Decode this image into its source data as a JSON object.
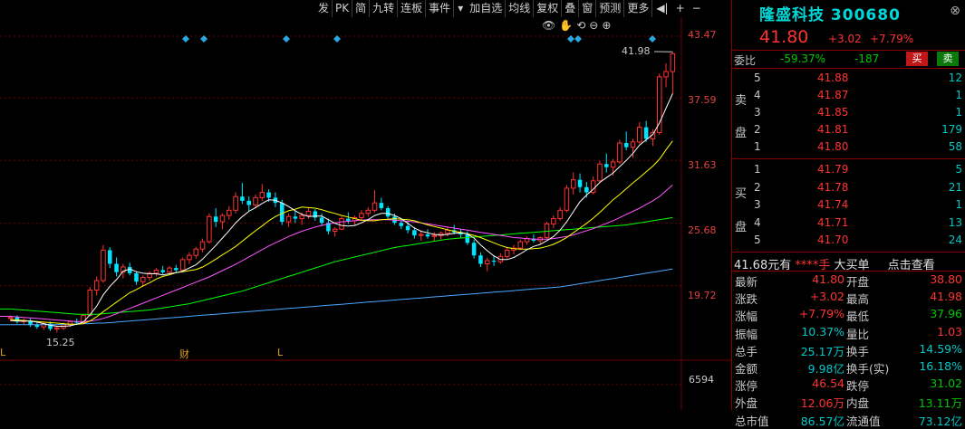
{
  "toolbar": {
    "buttons": [
      "发",
      "PK",
      "简",
      "九转",
      "连板",
      "事件",
      "加自选",
      "均线",
      "复权",
      "叠",
      "窗",
      "预测",
      "更多"
    ],
    "dropdown_icon": "triangle-down-icon",
    "icons": [
      "back-arrow-icon",
      "zoom-in-icon",
      "zoom-out-icon"
    ]
  },
  "chart_icons": [
    "eye-icon",
    "hand-icon",
    "replay-icon",
    "minus-icon",
    "plus-icon"
  ],
  "colors": {
    "up": "#ff3232",
    "down": "#00e5ff",
    "ma5": "#ffffff",
    "ma10": "#ffff00",
    "ma20": "#ff55ff",
    "ma60": "#00ff00",
    "ma120": "#4aa8ff",
    "grid": "#6b0000",
    "panel_border": "#8b0000"
  },
  "chart_data": {
    "type": "candlestick",
    "y_ticks": [
      "43.47",
      "37.59",
      "31.63",
      "25.68",
      "19.72"
    ],
    "ylim": [
      14.0,
      43.47
    ],
    "max_label": "41.98",
    "min_label": "15.25",
    "markers_bottom": [
      "财",
      "L"
    ],
    "volume_label": "6594",
    "ohlc": [
      [
        16.6,
        16.9,
        16.3,
        16.7
      ],
      [
        16.7,
        16.9,
        16.1,
        16.3
      ],
      [
        16.3,
        16.6,
        16.0,
        16.4
      ],
      [
        16.4,
        16.6,
        15.8,
        16.0
      ],
      [
        16.0,
        16.3,
        15.6,
        15.8
      ],
      [
        15.8,
        16.2,
        15.5,
        16.1
      ],
      [
        16.1,
        16.3,
        15.4,
        15.6
      ],
      [
        15.6,
        15.9,
        15.25,
        15.7
      ],
      [
        15.7,
        16.2,
        15.5,
        16.0
      ],
      [
        16.0,
        16.4,
        15.8,
        16.3
      ],
      [
        16.3,
        16.6,
        16.0,
        16.2
      ],
      [
        16.2,
        17.0,
        16.1,
        16.9
      ],
      [
        16.9,
        19.6,
        16.8,
        19.3
      ],
      [
        19.3,
        20.6,
        18.8,
        20.2
      ],
      [
        20.2,
        23.6,
        20.0,
        23.1
      ],
      [
        23.1,
        23.4,
        21.4,
        21.8
      ],
      [
        21.8,
        22.4,
        20.6,
        21.0
      ],
      [
        21.0,
        21.8,
        20.4,
        21.5
      ],
      [
        21.5,
        21.9,
        20.7,
        20.9
      ],
      [
        20.9,
        21.1,
        19.8,
        20.1
      ],
      [
        20.1,
        20.7,
        19.6,
        20.5
      ],
      [
        20.5,
        21.1,
        20.2,
        20.9
      ],
      [
        20.9,
        21.4,
        20.6,
        21.2
      ],
      [
        21.2,
        21.6,
        20.8,
        21.0
      ],
      [
        21.0,
        21.6,
        20.9,
        21.4
      ],
      [
        21.4,
        21.7,
        21.0,
        21.2
      ],
      [
        21.2,
        22.4,
        21.1,
        22.2
      ],
      [
        22.2,
        22.9,
        21.8,
        22.6
      ],
      [
        22.6,
        23.4,
        22.3,
        23.2
      ],
      [
        23.2,
        24.2,
        22.9,
        23.9
      ],
      [
        23.9,
        26.6,
        23.7,
        26.3
      ],
      [
        26.3,
        27.1,
        25.3,
        25.8
      ],
      [
        25.8,
        26.6,
        25.1,
        26.4
      ],
      [
        26.4,
        27.3,
        26.0,
        26.9
      ],
      [
        26.9,
        28.6,
        26.6,
        28.2
      ],
      [
        28.2,
        29.5,
        27.5,
        27.8
      ],
      [
        27.8,
        28.2,
        26.8,
        27.4
      ],
      [
        27.4,
        28.4,
        27.1,
        28.1
      ],
      [
        28.1,
        29.4,
        27.8,
        28.6
      ],
      [
        28.6,
        28.9,
        27.7,
        28.1
      ],
      [
        28.1,
        28.6,
        27.2,
        27.6
      ],
      [
        27.6,
        27.9,
        25.5,
        25.8
      ],
      [
        25.8,
        26.6,
        25.3,
        26.3
      ],
      [
        26.3,
        26.8,
        25.7,
        26.1
      ],
      [
        26.1,
        26.7,
        25.5,
        26.4
      ],
      [
        26.4,
        27.1,
        26.1,
        26.8
      ],
      [
        26.8,
        27.0,
        25.9,
        26.2
      ],
      [
        26.2,
        26.6,
        25.4,
        25.7
      ],
      [
        25.7,
        26.1,
        24.6,
        24.9
      ],
      [
        24.9,
        25.3,
        24.4,
        25.1
      ],
      [
        25.1,
        26.3,
        25.0,
        26.1
      ],
      [
        26.1,
        26.7,
        25.6,
        25.9
      ],
      [
        25.9,
        26.4,
        25.5,
        26.2
      ],
      [
        26.2,
        26.9,
        25.9,
        26.6
      ],
      [
        26.6,
        27.2,
        26.3,
        26.9
      ],
      [
        26.9,
        28.8,
        26.7,
        27.6
      ],
      [
        27.6,
        28.1,
        26.9,
        27.1
      ],
      [
        27.1,
        27.3,
        26.1,
        26.3
      ],
      [
        26.3,
        26.6,
        25.5,
        25.7
      ],
      [
        25.7,
        26.0,
        25.1,
        25.4
      ],
      [
        25.4,
        25.9,
        24.7,
        25.0
      ],
      [
        25.0,
        25.3,
        24.2,
        24.5
      ],
      [
        24.5,
        24.9,
        24.0,
        24.6
      ],
      [
        24.6,
        25.1,
        24.2,
        24.4
      ],
      [
        24.4,
        24.8,
        23.9,
        24.5
      ],
      [
        24.5,
        24.9,
        24.1,
        24.7
      ],
      [
        24.7,
        25.3,
        24.4,
        25.0
      ],
      [
        25.0,
        25.5,
        24.6,
        24.8
      ],
      [
        24.8,
        25.1,
        24.3,
        24.6
      ],
      [
        24.6,
        24.9,
        23.6,
        23.8
      ],
      [
        23.8,
        24.1,
        22.3,
        22.6
      ],
      [
        22.6,
        22.9,
        21.5,
        21.8
      ],
      [
        21.8,
        22.4,
        21.1,
        22.1
      ],
      [
        22.1,
        22.6,
        21.6,
        22.0
      ],
      [
        22.0,
        22.8,
        21.8,
        22.5
      ],
      [
        22.5,
        23.4,
        22.3,
        23.1
      ],
      [
        23.1,
        23.6,
        22.7,
        23.3
      ],
      [
        23.3,
        24.1,
        23.1,
        23.9
      ],
      [
        23.9,
        24.4,
        23.6,
        24.2
      ],
      [
        24.2,
        24.6,
        23.8,
        24.0
      ],
      [
        24.0,
        24.4,
        23.7,
        24.3
      ],
      [
        24.3,
        25.8,
        24.2,
        25.6
      ],
      [
        25.6,
        26.4,
        25.2,
        26.1
      ],
      [
        26.1,
        27.2,
        25.9,
        26.9
      ],
      [
        26.9,
        29.3,
        26.7,
        29.0
      ],
      [
        29.0,
        30.5,
        28.4,
        29.8
      ],
      [
        29.8,
        30.4,
        28.6,
        29.1
      ],
      [
        29.1,
        29.6,
        28.1,
        28.6
      ],
      [
        28.6,
        30.1,
        28.4,
        29.7
      ],
      [
        29.7,
        31.6,
        29.5,
        31.3
      ],
      [
        31.3,
        32.3,
        30.5,
        31.0
      ],
      [
        31.0,
        31.8,
        30.2,
        31.5
      ],
      [
        31.5,
        33.6,
        31.3,
        33.3
      ],
      [
        33.3,
        34.4,
        32.6,
        32.9
      ],
      [
        32.9,
        33.7,
        31.9,
        33.4
      ],
      [
        33.4,
        35.3,
        33.2,
        34.8
      ],
      [
        34.8,
        35.4,
        33.4,
        33.7
      ],
      [
        33.7,
        34.6,
        33.0,
        34.3
      ],
      [
        34.3,
        39.9,
        34.1,
        39.6
      ],
      [
        39.6,
        40.9,
        38.6,
        40.1
      ],
      [
        40.1,
        41.98,
        37.96,
        41.8
      ]
    ],
    "ma5": [
      16.4,
      16.35,
      16.35,
      16.35,
      16.25,
      16.1,
      15.95,
      15.85,
      15.85,
      15.9,
      16.05,
      16.25,
      16.95,
      17.75,
      18.85,
      19.65,
      20.3,
      21.1,
      21.3,
      21.05,
      20.9,
      20.85,
      20.85,
      20.75,
      20.85,
      20.95,
      21.1,
      21.4,
      21.7,
      22.25,
      22.9,
      23.55,
      24.25,
      24.95,
      25.7,
      26.3,
      26.8,
      27.15,
      27.55,
      27.9,
      27.85,
      27.6,
      27.25,
      26.85,
      26.5,
      26.3,
      26.35,
      26.35,
      26.0,
      25.65,
      25.45,
      25.4,
      25.45,
      25.7,
      26.0,
      26.4,
      26.6,
      26.6,
      26.4,
      26.1,
      25.65,
      25.2,
      24.9,
      24.75,
      24.6,
      24.55,
      24.6,
      24.7,
      24.75,
      24.65,
      24.25,
      23.6,
      23.05,
      22.55,
      22.2,
      22.2,
      22.4,
      22.75,
      23.15,
      23.45,
      23.65,
      24.0,
      24.4,
      25.0,
      25.8,
      26.75,
      27.7,
      28.35,
      28.9,
      29.55,
      30.0,
      30.45,
      31.05,
      31.65,
      32.3,
      33.1,
      33.6,
      34.1,
      35.2,
      36.6,
      38.0
    ],
    "ma10": [
      16.5,
      16.45,
      16.4,
      16.35,
      16.3,
      16.25,
      16.2,
      16.15,
      16.1,
      16.05,
      16.05,
      16.1,
      16.35,
      16.75,
      17.25,
      17.7,
      18.15,
      18.6,
      19.05,
      19.35,
      19.7,
      20.0,
      20.35,
      20.6,
      20.75,
      20.95,
      21.05,
      21.15,
      21.25,
      21.5,
      21.85,
      22.25,
      22.65,
      23.05,
      23.45,
      23.95,
      24.45,
      24.95,
      25.4,
      25.9,
      26.3,
      26.6,
      26.85,
      27.0,
      27.2,
      27.15,
      27.1,
      26.95,
      26.75,
      26.6,
      26.4,
      26.25,
      26.1,
      25.95,
      25.9,
      25.9,
      26.0,
      26.05,
      26.1,
      26.05,
      26.0,
      25.9,
      25.7,
      25.5,
      25.35,
      25.2,
      25.05,
      24.9,
      24.8,
      24.65,
      24.5,
      24.3,
      24.05,
      23.8,
      23.55,
      23.35,
      23.25,
      23.2,
      23.2,
      23.25,
      23.3,
      23.45,
      23.65,
      23.95,
      24.3,
      24.75,
      25.2,
      25.65,
      26.15,
      26.7,
      27.3,
      27.9,
      28.4,
      28.95,
      29.5,
      30.0,
      30.55,
      31.1,
      31.75,
      32.65,
      33.5
    ],
    "ma20": [
      16.8,
      16.75,
      16.7,
      16.65,
      16.6,
      16.55,
      16.5,
      16.45,
      16.4,
      16.35,
      16.3,
      16.3,
      16.35,
      16.45,
      16.6,
      16.8,
      17.05,
      17.3,
      17.55,
      17.8,
      18.05,
      18.3,
      18.55,
      18.8,
      19.05,
      19.3,
      19.55,
      19.8,
      20.05,
      20.3,
      20.55,
      20.85,
      21.15,
      21.45,
      21.75,
      22.1,
      22.45,
      22.8,
      23.15,
      23.5,
      23.8,
      24.1,
      24.4,
      24.65,
      24.9,
      25.1,
      25.3,
      25.45,
      25.6,
      25.7,
      25.8,
      25.85,
      25.9,
      25.95,
      26.0,
      26.0,
      26.0,
      26.0,
      25.95,
      25.9,
      25.85,
      25.8,
      25.7,
      25.6,
      25.5,
      25.4,
      25.3,
      25.2,
      25.1,
      25.0,
      24.9,
      24.8,
      24.7,
      24.6,
      24.5,
      24.4,
      24.3,
      24.25,
      24.2,
      24.15,
      24.15,
      24.15,
      24.2,
      24.3,
      24.4,
      24.55,
      24.75,
      24.95,
      25.15,
      25.4,
      25.65,
      25.9,
      26.2,
      26.5,
      26.8,
      27.1,
      27.45,
      27.8,
      28.2,
      28.75,
      29.3
    ],
    "ma60": [
      17.5,
      17.45,
      17.4,
      17.35,
      17.3,
      17.25,
      17.2,
      17.15,
      17.1,
      17.05,
      17.0,
      17.0,
      17.0,
      17.0,
      17.05,
      17.1,
      17.15,
      17.2,
      17.25,
      17.3,
      17.35,
      17.4,
      17.5,
      17.6,
      17.7,
      17.8,
      17.9,
      18.0,
      18.15,
      18.3,
      18.45,
      18.6,
      18.75,
      18.9,
      19.05,
      19.2,
      19.4,
      19.6,
      19.8,
      20.0,
      20.2,
      20.4,
      20.6,
      20.8,
      21.0,
      21.2,
      21.4,
      21.6,
      21.8,
      22.0,
      22.15,
      22.3,
      22.45,
      22.6,
      22.75,
      22.9,
      23.05,
      23.2,
      23.35,
      23.45,
      23.55,
      23.65,
      23.75,
      23.85,
      23.95,
      24.05,
      24.15,
      24.2,
      24.25,
      24.3,
      24.35,
      24.4,
      24.45,
      24.5,
      24.55,
      24.6,
      24.65,
      24.7,
      24.75,
      24.8,
      24.85,
      24.9,
      24.95,
      25.0,
      25.05,
      25.1,
      25.15,
      25.2,
      25.25,
      25.3,
      25.35,
      25.4,
      25.45,
      25.5,
      25.6,
      25.7,
      25.8,
      25.9,
      26.0,
      26.1,
      26.2
    ],
    "ma120": [
      16.0,
      16.0,
      16.0,
      16.0,
      16.0,
      16.0,
      16.0,
      16.0,
      16.05,
      16.05,
      16.05,
      16.1,
      16.1,
      16.15,
      16.15,
      16.2,
      16.25,
      16.3,
      16.35,
      16.4,
      16.45,
      16.5,
      16.55,
      16.6,
      16.65,
      16.7,
      16.75,
      16.8,
      16.85,
      16.9,
      16.95,
      17.0,
      17.05,
      17.1,
      17.15,
      17.2,
      17.25,
      17.3,
      17.35,
      17.4,
      17.45,
      17.5,
      17.55,
      17.6,
      17.65,
      17.7,
      17.75,
      17.8,
      17.85,
      17.9,
      17.95,
      18.0,
      18.05,
      18.1,
      18.15,
      18.2,
      18.25,
      18.3,
      18.35,
      18.4,
      18.45,
      18.5,
      18.55,
      18.6,
      18.65,
      18.7,
      18.75,
      18.8,
      18.85,
      18.9,
      18.95,
      19.0,
      19.05,
      19.1,
      19.15,
      19.2,
      19.25,
      19.3,
      19.35,
      19.4,
      19.45,
      19.5,
      19.55,
      19.6,
      19.7,
      19.8,
      19.9,
      20.0,
      20.1,
      20.2,
      20.3,
      20.4,
      20.5,
      20.6,
      20.7,
      20.8,
      20.9,
      21.0,
      21.1,
      21.2,
      21.3
    ]
  },
  "quote": {
    "name": "隆盛科技",
    "code": "300680",
    "price": "41.80",
    "change": "+3.02",
    "change_pct": "+7.79%",
    "weibi_label": "委比",
    "weibi_pct": "-59.37%",
    "weibi_diff": "-187",
    "buy_label": "买",
    "sell_label": "卖",
    "sell_side_label": [
      "卖",
      "盘"
    ],
    "buy_side_label": [
      "买",
      "盘"
    ],
    "asks": [
      {
        "level": "5",
        "price": "41.88",
        "vol": "12"
      },
      {
        "level": "4",
        "price": "41.87",
        "vol": "1"
      },
      {
        "level": "3",
        "price": "41.85",
        "vol": "1"
      },
      {
        "level": "2",
        "price": "41.81",
        "vol": "179"
      },
      {
        "level": "1",
        "price": "41.80",
        "vol": "58"
      }
    ],
    "bids": [
      {
        "level": "1",
        "price": "41.79",
        "vol": "5"
      },
      {
        "level": "2",
        "price": "41.78",
        "vol": "21"
      },
      {
        "level": "3",
        "price": "41.74",
        "vol": "1"
      },
      {
        "level": "4",
        "price": "41.71",
        "vol": "13"
      },
      {
        "level": "5",
        "price": "41.70",
        "vol": "24"
      }
    ],
    "info_bar": {
      "price": "41.68元有",
      "stars": "****手",
      "label": "大买单",
      "link": "点击查看"
    },
    "stats": [
      {
        "l1": "最新",
        "v1": "41.80",
        "c1": "red",
        "l2": "开盘",
        "v2": "38.80",
        "c2": "red"
      },
      {
        "l1": "涨跌",
        "v1": "+3.02",
        "c1": "red",
        "l2": "最高",
        "v2": "41.98",
        "c2": "red"
      },
      {
        "l1": "涨幅",
        "v1": "+7.79%",
        "c1": "red",
        "l2": "最低",
        "v2": "37.96",
        "c2": "green"
      },
      {
        "l1": "振幅",
        "v1": "10.37%",
        "c1": "cyan",
        "l2": "量比",
        "v2": "1.03",
        "c2": "red"
      },
      {
        "l1": "总手",
        "v1": "25.17万",
        "c1": "cyan",
        "l2": "换手",
        "v2": "14.59%",
        "c2": "cyan"
      },
      {
        "l1": "金额",
        "v1": "9.98亿",
        "c1": "cyan",
        "l2": "换手(实)",
        "v2": "16.18%",
        "c2": "cyan"
      },
      {
        "l1": "涨停",
        "v1": "46.54",
        "c1": "red",
        "l2": "跌停",
        "v2": "31.02",
        "c2": "green"
      },
      {
        "l1": "外盘",
        "v1": "12.06万",
        "c1": "red",
        "l2": "内盘",
        "v2": "13.11万",
        "c2": "green"
      },
      {
        "l1": "总市值",
        "v1": "86.57亿",
        "c1": "cyan",
        "l2": "流通值",
        "v2": "73.12亿",
        "c2": "cyan"
      }
    ]
  }
}
